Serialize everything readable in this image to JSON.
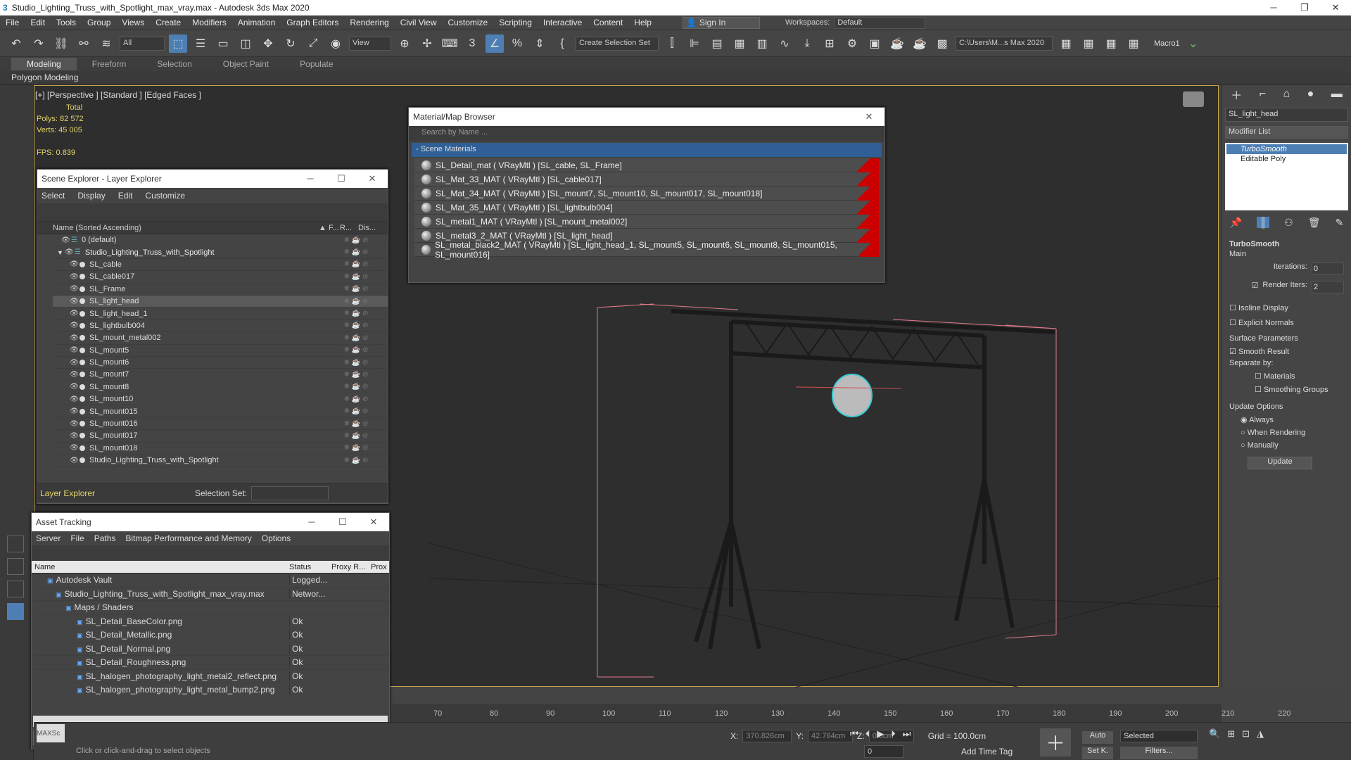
{
  "title": "Studio_Lighting_Truss_with_Spotlight_max_vray.max - Autodesk 3ds Max 2020",
  "menu": [
    "File",
    "Edit",
    "Tools",
    "Group",
    "Views",
    "Create",
    "Modifiers",
    "Animation",
    "Graph Editors",
    "Rendering",
    "Civil View",
    "Customize",
    "Scripting",
    "Interactive",
    "Content",
    "Help"
  ],
  "signin": "Sign In",
  "workspaces_label": "Workspaces:",
  "workspace": "Default",
  "toolbar": {
    "filter": "All",
    "refcoord": "View",
    "selset": "Create Selection Set",
    "path": "C:\\Users\\M...s Max 2020",
    "macro": "Macro1"
  },
  "ribbon_tabs": [
    "Modeling",
    "Freeform",
    "Selection",
    "Object Paint",
    "Populate"
  ],
  "ribbon_sub": "Polygon Modeling",
  "viewport": {
    "label": "[+] [Perspective ] [Standard ] [Edged Faces ]",
    "total_label": "Total",
    "polys_label": "Polys:",
    "polys": "82 572",
    "verts_label": "Verts:",
    "verts": "45 005",
    "fps_label": "FPS:",
    "fps": "0.839"
  },
  "scene_explorer": {
    "title": "Scene Explorer - Layer Explorer",
    "menu": [
      "Select",
      "Display",
      "Edit",
      "Customize"
    ],
    "col_name": "Name (Sorted Ascending)",
    "col_f": "▲ F...",
    "col_r": "R...",
    "col_d": "Dis...",
    "rows": [
      "0 (default)",
      "Studio_Lighting_Truss_with_Spotlight",
      "SL_cable",
      "SL_cable017",
      "SL_Frame",
      "SL_light_head",
      "SL_light_head_1",
      "SL_lightbulb004",
      "SL_mount_metal002",
      "SL_mount5",
      "SL_mount6",
      "SL_mount7",
      "SL_mount8",
      "SL_mount10",
      "SL_mount015",
      "SL_mount016",
      "SL_mount017",
      "SL_mount018",
      "Studio_Lighting_Truss_with_Spotlight"
    ],
    "layer_label": "Layer Explorer",
    "selset_label": "Selection Set:"
  },
  "material_browser": {
    "title": "Material/Map Browser",
    "search_placeholder": "Search by Name ...",
    "group": "- Scene Materials",
    "rows": [
      "SL_Detail_mat  ( VRayMtl ) [SL_cable, SL_Frame]",
      "SL_Mat_33_MAT  ( VRayMtl ) [SL_cable017]",
      "SL_Mat_34_MAT  ( VRayMtl ) [SL_mount7, SL_mount10, SL_mount017, SL_mount018]",
      "SL_Mat_35_MAT  ( VRayMtl ) [SL_lightbulb004]",
      "SL_metal1_MAT  ( VRayMtl ) [SL_mount_metal002]",
      "SL_metal3_2_MAT  ( VRayMtl ) [SL_light_head]",
      "SL_metal_black2_MAT  ( VRayMtl ) [SL_light_head_1, SL_mount5, SL_mount6, SL_mount8, SL_mount015, SL_mount016]"
    ]
  },
  "asset": {
    "title": "Asset Tracking",
    "menu": [
      "Server",
      "File",
      "Paths",
      "Bitmap Performance and Memory",
      "Options"
    ],
    "cols": [
      "Name",
      "Status",
      "Proxy R...",
      "Prox"
    ],
    "rows": [
      {
        "name": "Autodesk Vault",
        "status": "Logged..."
      },
      {
        "name": "Studio_Lighting_Truss_with_Spotlight_max_vray.max",
        "status": "Networ..."
      },
      {
        "name": "Maps / Shaders",
        "status": ""
      },
      {
        "name": "SL_Detail_BaseColor.png",
        "status": "Ok"
      },
      {
        "name": "SL_Detail_Metallic.png",
        "status": "Ok"
      },
      {
        "name": "SL_Detail_Normal.png",
        "status": "Ok"
      },
      {
        "name": "SL_Detail_Roughness.png",
        "status": "Ok"
      },
      {
        "name": "SL_halogen_photography_light_metal2_reflect.png",
        "status": "Ok"
      },
      {
        "name": "SL_halogen_photography_light_metal_bump2.png",
        "status": "Ok"
      }
    ]
  },
  "cmd": {
    "object_name": "SL_light_head",
    "modlist": "Modifier List",
    "stack": [
      "TurboSmooth",
      "Editable Poly"
    ],
    "rollout": "TurboSmooth",
    "main": "Main",
    "iterations_label": "Iterations:",
    "iterations": "0",
    "render_iters_label": "Render Iters:",
    "render_iters": "2",
    "isoline": "Isoline Display",
    "explicit": "Explicit Normals",
    "surface": "Surface Parameters",
    "smooth_result": "Smooth Result",
    "separate": "Separate by:",
    "materials": "Materials",
    "smoothing": "Smoothing Groups",
    "update_opts": "Update Options",
    "always": "Always",
    "when_render": "When Rendering",
    "manually": "Manually",
    "update_btn": "Update"
  },
  "timeline": [
    "70",
    "80",
    "90",
    "100",
    "110",
    "120",
    "130",
    "140",
    "150",
    "160",
    "170",
    "180",
    "190",
    "200",
    "210",
    "220"
  ],
  "status": {
    "x_label": "X:",
    "x": "370.826cm",
    "y_label": "Y:",
    "y": "42.764cm",
    "z_label": "Z:",
    "z": "0.0cm",
    "grid": "Grid = 100.0cm",
    "addtime": "Add Time Tag",
    "auto": "Auto",
    "selected": "Selected",
    "setk": "Set K.",
    "filters": "Filters...",
    "frame": "0",
    "prompt": "Click or click-and-drag to select objects",
    "maxscript": "MAXSc"
  }
}
